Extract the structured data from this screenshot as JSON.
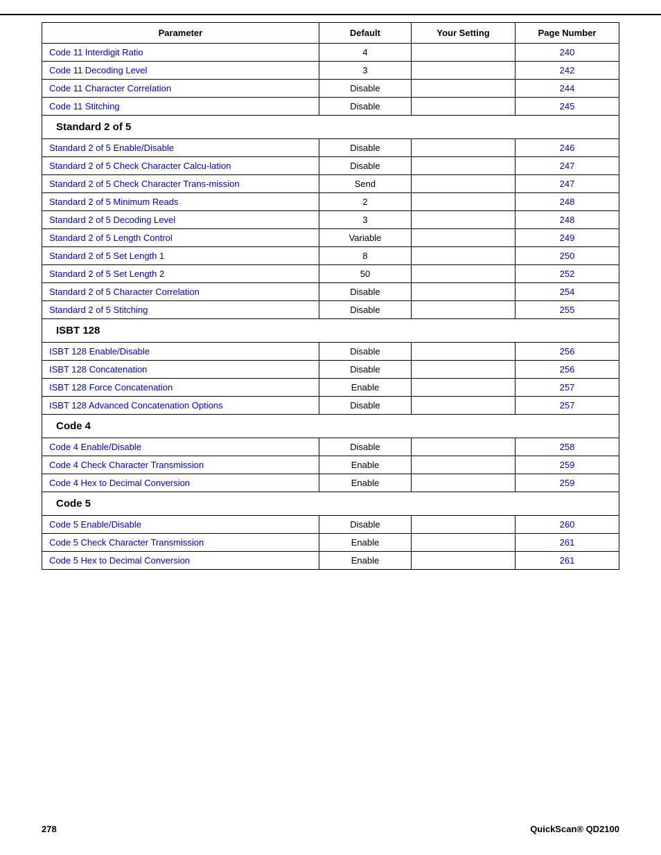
{
  "page": {
    "top_border": true,
    "footer": {
      "left": "278",
      "right": "QuickScan® QD2100"
    }
  },
  "table": {
    "headers": {
      "parameter": "Parameter",
      "default": "Default",
      "your_setting": "Your Setting",
      "page_number": "Page Number"
    },
    "rows": [
      {
        "type": "data",
        "param": "Code 11 Interdigit Ratio",
        "default": "4",
        "page": "240"
      },
      {
        "type": "data",
        "param": "Code 11 Decoding Level",
        "default": "3",
        "page": "242"
      },
      {
        "type": "data",
        "param": "Code 11 Character Correlation",
        "default": "Disable",
        "page": "244"
      },
      {
        "type": "data",
        "param": "Code 11 Stitching",
        "default": "Disable",
        "page": "245"
      },
      {
        "type": "section",
        "label": "Standard 2 of 5"
      },
      {
        "type": "data",
        "param": "Standard 2 of 5 Enable/Disable",
        "default": "Disable",
        "page": "246"
      },
      {
        "type": "data",
        "param": "Standard 2 of 5 Check Character Calcu-lation",
        "default": "Disable",
        "page": "247"
      },
      {
        "type": "data",
        "param": "Standard 2 of 5 Check Character Trans-mission",
        "default": "Send",
        "page": "247"
      },
      {
        "type": "data",
        "param": "Standard 2 of 5 Minimum Reads",
        "default": "2",
        "page": "248"
      },
      {
        "type": "data",
        "param": "Standard 2 of 5 Decoding Level",
        "default": "3",
        "page": "248"
      },
      {
        "type": "data",
        "param": "Standard 2 of 5 Length Control",
        "default": "Variable",
        "page": "249"
      },
      {
        "type": "data",
        "param": "Standard 2 of 5 Set Length 1",
        "default": "8",
        "page": "250"
      },
      {
        "type": "data",
        "param": "Standard 2 of 5 Set Length 2",
        "default": "50",
        "page": "252"
      },
      {
        "type": "data",
        "param": "Standard 2 of 5 Character Correlation",
        "default": "Disable",
        "page": "254"
      },
      {
        "type": "data",
        "param": "Standard 2 of 5 Stitching",
        "default": "Disable",
        "page": "255"
      },
      {
        "type": "section",
        "label": "ISBT 128"
      },
      {
        "type": "data",
        "param": "ISBT 128 Enable/Disable",
        "default": "Disable",
        "page": "256"
      },
      {
        "type": "data",
        "param": "ISBT 128 Concatenation",
        "default": "Disable",
        "page": "256"
      },
      {
        "type": "data",
        "param": "ISBT 128 Force Concatenation",
        "default": "Enable",
        "page": "257"
      },
      {
        "type": "data",
        "param": "ISBT 128 Advanced Concatenation Options",
        "default": "Disable",
        "page": "257"
      },
      {
        "type": "section",
        "label": "Code 4"
      },
      {
        "type": "data",
        "param": "Code 4 Enable/Disable",
        "default": "Disable",
        "page": "258"
      },
      {
        "type": "data",
        "param": "Code 4 Check Character Transmission",
        "default": "Enable",
        "page": "259"
      },
      {
        "type": "data",
        "param": "Code 4 Hex to Decimal Conversion",
        "default": "Enable",
        "page": "259"
      },
      {
        "type": "section",
        "label": "Code 5"
      },
      {
        "type": "data",
        "param": "Code 5 Enable/Disable",
        "default": "Disable",
        "page": "260"
      },
      {
        "type": "data",
        "param": "Code 5 Check Character Transmission",
        "default": "Enable",
        "page": "261"
      },
      {
        "type": "data",
        "param": "Code 5 Hex to Decimal Conversion",
        "default": "Enable",
        "page": "261"
      }
    ]
  }
}
